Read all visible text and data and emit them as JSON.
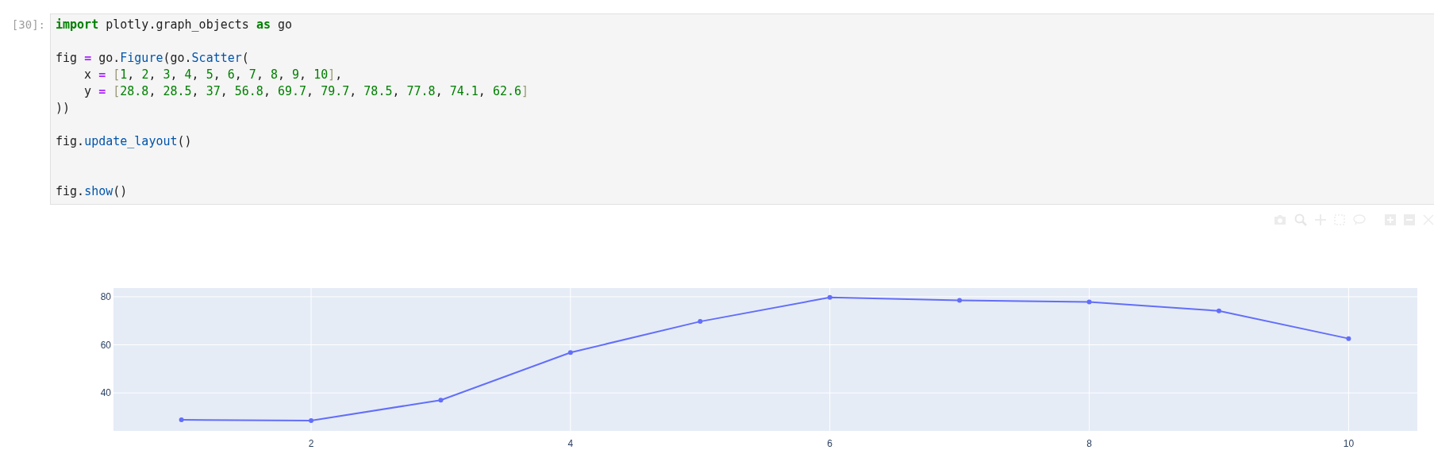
{
  "cell": {
    "prompt": "[30]:",
    "lines": [
      {
        "kind": "code",
        "segments": [
          {
            "kind": "keyword",
            "text": "import"
          },
          {
            "kind": "plain",
            "text": " plotly.graph_objects "
          },
          {
            "kind": "keyword",
            "text": "as"
          },
          {
            "kind": "plain",
            "text": " go"
          }
        ]
      },
      {
        "kind": "blank"
      },
      {
        "kind": "code",
        "segments": [
          {
            "kind": "plain",
            "text": "fig "
          },
          {
            "kind": "operator",
            "text": "="
          },
          {
            "kind": "plain",
            "text": " go."
          },
          {
            "kind": "name",
            "text": "Figure"
          },
          {
            "kind": "plain",
            "text": "(go."
          },
          {
            "kind": "name",
            "text": "Scatter"
          },
          {
            "kind": "plain",
            "text": "("
          }
        ]
      },
      {
        "kind": "code",
        "segments": [
          {
            "kind": "plain",
            "text": "    x "
          },
          {
            "kind": "operator",
            "text": "="
          },
          {
            "kind": "bracket",
            "text": " ["
          },
          {
            "kind": "number",
            "text": "1"
          },
          {
            "kind": "plain",
            "text": ", "
          },
          {
            "kind": "number",
            "text": "2"
          },
          {
            "kind": "plain",
            "text": ", "
          },
          {
            "kind": "number",
            "text": "3"
          },
          {
            "kind": "plain",
            "text": ", "
          },
          {
            "kind": "number",
            "text": "4"
          },
          {
            "kind": "plain",
            "text": ", "
          },
          {
            "kind": "number",
            "text": "5"
          },
          {
            "kind": "plain",
            "text": ", "
          },
          {
            "kind": "number",
            "text": "6"
          },
          {
            "kind": "plain",
            "text": ", "
          },
          {
            "kind": "number",
            "text": "7"
          },
          {
            "kind": "plain",
            "text": ", "
          },
          {
            "kind": "number",
            "text": "8"
          },
          {
            "kind": "plain",
            "text": ", "
          },
          {
            "kind": "number",
            "text": "9"
          },
          {
            "kind": "plain",
            "text": ", "
          },
          {
            "kind": "number",
            "text": "10"
          },
          {
            "kind": "bracket",
            "text": "]"
          },
          {
            "kind": "plain",
            "text": ","
          }
        ]
      },
      {
        "kind": "code",
        "segments": [
          {
            "kind": "plain",
            "text": "    y "
          },
          {
            "kind": "operator",
            "text": "="
          },
          {
            "kind": "bracket",
            "text": " ["
          },
          {
            "kind": "number",
            "text": "28.8"
          },
          {
            "kind": "plain",
            "text": ", "
          },
          {
            "kind": "number",
            "text": "28.5"
          },
          {
            "kind": "plain",
            "text": ", "
          },
          {
            "kind": "number",
            "text": "37"
          },
          {
            "kind": "plain",
            "text": ", "
          },
          {
            "kind": "number",
            "text": "56.8"
          },
          {
            "kind": "plain",
            "text": ", "
          },
          {
            "kind": "number",
            "text": "69.7"
          },
          {
            "kind": "plain",
            "text": ", "
          },
          {
            "kind": "number",
            "text": "79.7"
          },
          {
            "kind": "plain",
            "text": ", "
          },
          {
            "kind": "number",
            "text": "78.5"
          },
          {
            "kind": "plain",
            "text": ", "
          },
          {
            "kind": "number",
            "text": "77.8"
          },
          {
            "kind": "plain",
            "text": ", "
          },
          {
            "kind": "number",
            "text": "74.1"
          },
          {
            "kind": "plain",
            "text": ", "
          },
          {
            "kind": "number",
            "text": "62.6"
          },
          {
            "kind": "bracket",
            "text": "]"
          }
        ]
      },
      {
        "kind": "code",
        "segments": [
          {
            "kind": "plain",
            "text": "))"
          }
        ]
      },
      {
        "kind": "blank"
      },
      {
        "kind": "code",
        "segments": [
          {
            "kind": "plain",
            "text": "fig."
          },
          {
            "kind": "name",
            "text": "update_layout"
          },
          {
            "kind": "plain",
            "text": "()"
          }
        ]
      },
      {
        "kind": "blank"
      },
      {
        "kind": "blank"
      },
      {
        "kind": "code",
        "segments": [
          {
            "kind": "plain",
            "text": "fig."
          },
          {
            "kind": "name",
            "text": "show"
          },
          {
            "kind": "plain",
            "text": "()"
          }
        ]
      }
    ]
  },
  "output": {
    "chart_data": {
      "type": "line",
      "x": [
        1,
        2,
        3,
        4,
        5,
        6,
        7,
        8,
        9,
        10
      ],
      "grid": true,
      "series": [
        {
          "color": "#636efa",
          "marker": true,
          "values": [
            28.8,
            28.5,
            37,
            56.8,
            69.7,
            79.7,
            78.5,
            77.8,
            74.1,
            62.6
          ]
        }
      ],
      "xlim": [
        0.476,
        10.53
      ],
      "ylim": [
        24.2,
        83.6
      ],
      "xticks": [
        2,
        4,
        6,
        8,
        10
      ],
      "yticks": [
        40,
        60,
        80
      ]
    }
  }
}
